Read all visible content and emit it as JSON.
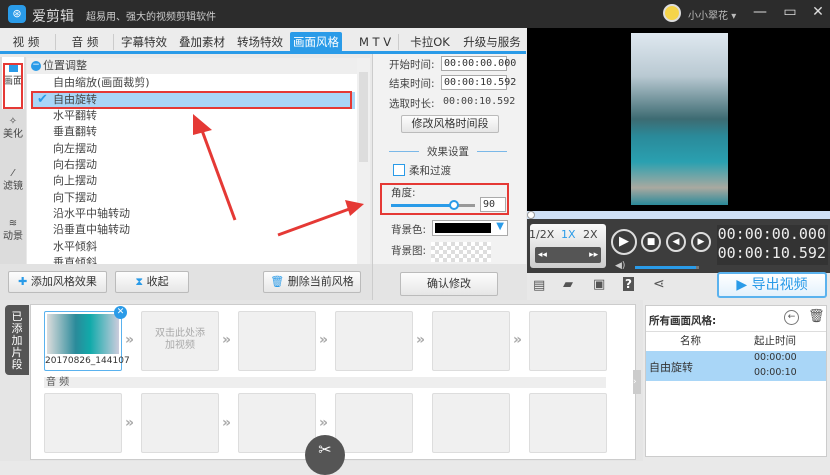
{
  "app": {
    "logo_glyph": "⊛",
    "name": "爱剪辑",
    "slogan": "超易用、强大的视频剪辑软件",
    "user": "小小翠花"
  },
  "window": {
    "minimize": "—",
    "maximize": "▭",
    "close": "✕"
  },
  "tabs": [
    {
      "label": "视 频"
    },
    {
      "label": "音 频"
    },
    {
      "label": "字幕特效"
    },
    {
      "label": "叠加素材"
    },
    {
      "label": "转场特效"
    },
    {
      "label": "画面风格",
      "active": true
    },
    {
      "label": "M T V"
    },
    {
      "label": "卡拉OK"
    },
    {
      "label": "升级与服务"
    }
  ],
  "side_tabs": [
    {
      "label": "画面"
    },
    {
      "label": "美化"
    },
    {
      "label": "滤镜"
    },
    {
      "label": "动景"
    }
  ],
  "list": {
    "group": "位置调整",
    "items": [
      "自由缩放(画面裁剪)",
      "自由旋转",
      "水平翻转",
      "垂直翻转",
      "向左摆动",
      "向右摆动",
      "向上摆动",
      "向下摆动",
      "沿水平中轴转动",
      "沿垂直中轴转动",
      "水平倾斜",
      "垂直倾斜"
    ],
    "selected": 1
  },
  "list_buttons": {
    "add": "添加风格效果",
    "collapse": "收起",
    "delete": "删除当前风格"
  },
  "settings": {
    "start_label": "开始时间:",
    "start": "00:00:00.000",
    "end_label": "结束时间:",
    "end": "00:00:10.592",
    "dur_label": "选取时长:",
    "duration": "00:00:10.592",
    "modify_btn": "修改风格时间段",
    "section": "效果设置",
    "soft_label": "柔和过渡",
    "angle_label": "角度:",
    "angle": "90",
    "angle_fraction": 0.75,
    "bgcolor_label": "背景色:",
    "bgcolor": "#000000",
    "bgimg_label": "背景图:",
    "confirm": "确认修改"
  },
  "player": {
    "speeds": [
      "1/2X",
      "1X",
      "2X"
    ],
    "time_current": "00:00:00.000",
    "time_total": "00:00:10.592",
    "volume_fraction": 0.95,
    "export": "导出视频"
  },
  "timeline": {
    "side_label": "已添加片段",
    "clip_name": "20170826_144107",
    "add_hint": "双击此处添加视频",
    "audio_label": "音 频"
  },
  "styles_panel": {
    "title": "所有画面风格:",
    "col_name": "名称",
    "col_time": "起止时间",
    "rows": [
      {
        "name": "自由旋转",
        "start": "00:00:00",
        "end": "00:00:10"
      }
    ]
  },
  "colors": {
    "accent": "#2a9be8",
    "highlight": "#a9d6f7",
    "annotation": "#e53935"
  }
}
